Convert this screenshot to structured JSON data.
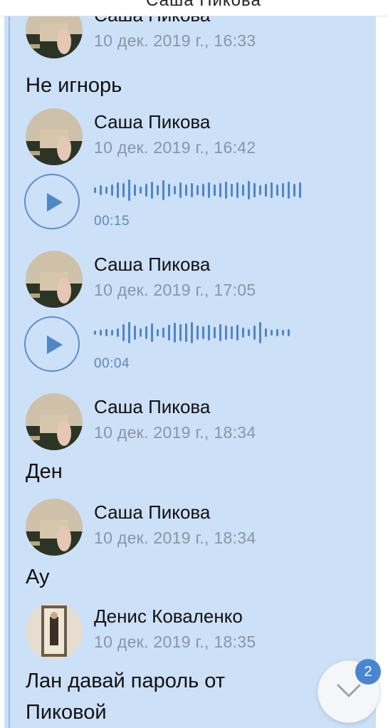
{
  "header": {
    "title_fragment": "..."
  },
  "messages": [
    {
      "author": "Саша Пикова",
      "time": "10 дек. 2019 г., 16:33",
      "text": "Не игнорь",
      "avatar": "sasha-avatar"
    },
    {
      "author": "Саша Пикова",
      "time": "10 дек. 2019 г., 16:42",
      "voice_duration": "00:15",
      "avatar": "sasha-avatar"
    },
    {
      "author": "Саша Пикова",
      "time": "10 дек. 2019 г., 17:05",
      "voice_duration": "00:04",
      "avatar": "sasha-avatar"
    },
    {
      "author": "Саша Пикова",
      "time": "10 дек. 2019 г., 18:34",
      "text": "Ден",
      "avatar": "sasha-avatar"
    },
    {
      "author": "Саша Пикова",
      "time": "10 дек. 2019 г., 18:34",
      "text": "Ау",
      "avatar": "sasha-avatar"
    },
    {
      "author": "Денис Коваленко",
      "time": "10 дек. 2019 г., 18:35",
      "text": "Лан давай пароль от Пиковой",
      "avatar": "denis-avatar"
    }
  ],
  "scroll_down": {
    "unread_count": "2",
    "icon": "chevron-down-icon"
  },
  "colors": {
    "thread_bg": "#cce0f8",
    "accent": "#4a86cf",
    "waveform": "#4f86c6",
    "time_text": "#8a95a3"
  }
}
